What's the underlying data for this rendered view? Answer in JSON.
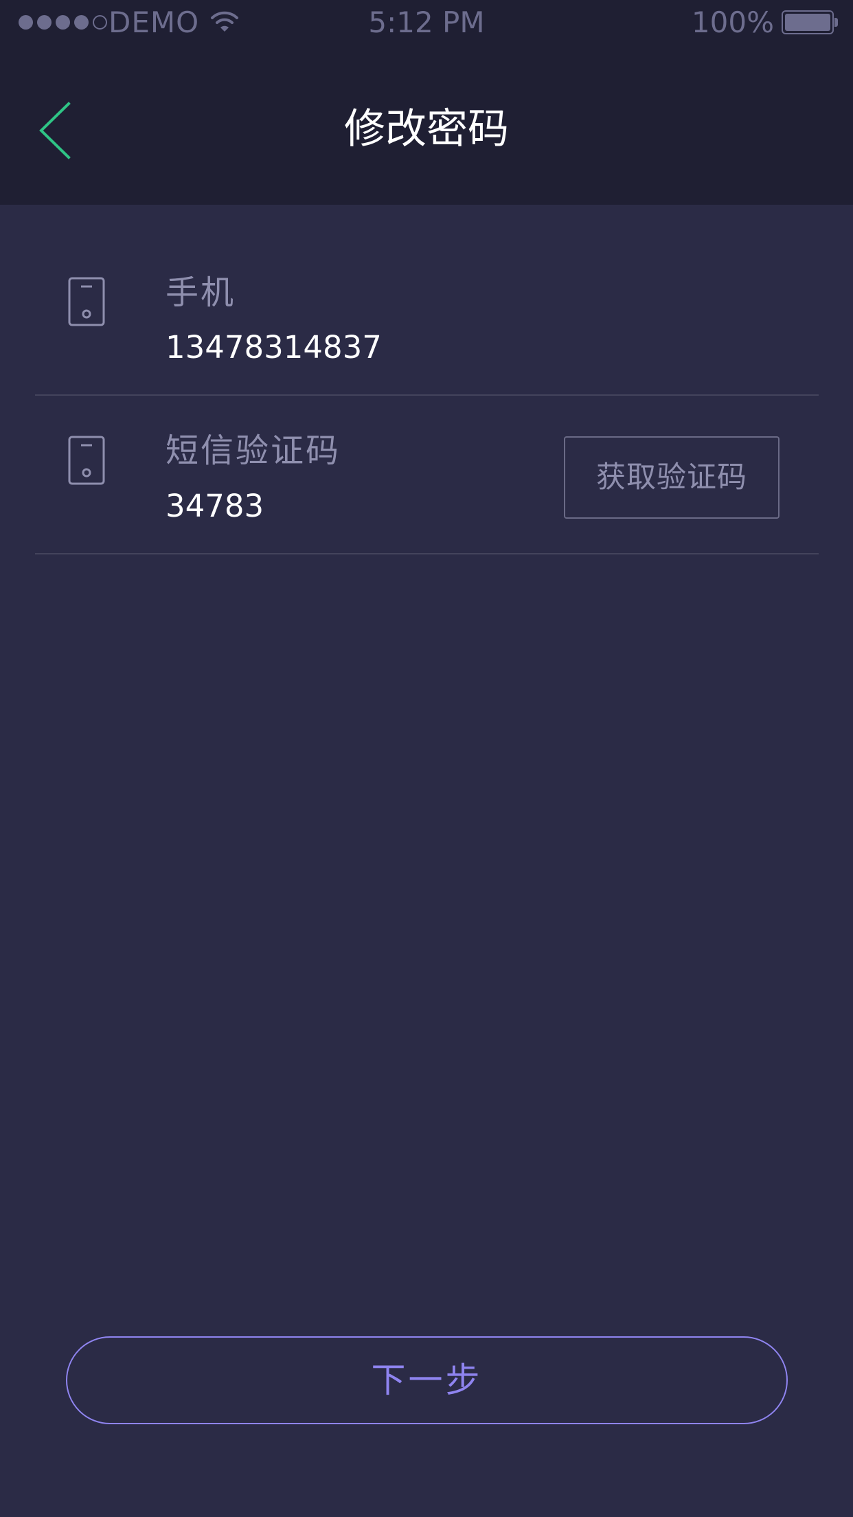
{
  "status_bar": {
    "carrier": "DEMO",
    "time": "5:12 PM",
    "battery": "100%",
    "signal_bars_filled": 4,
    "signal_bars_total": 5
  },
  "header": {
    "title": "修改密码",
    "back_icon": "chevron-left-icon",
    "accent_color": "#2fc586"
  },
  "form": {
    "phone": {
      "label": "手机",
      "value": "13478314837",
      "icon": "phone-icon"
    },
    "sms_code": {
      "label": "短信验证码",
      "value": "34783",
      "icon": "phone-icon",
      "button_label": "获取验证码"
    }
  },
  "next_button": {
    "label": "下一步",
    "color": "#8f84f0"
  }
}
